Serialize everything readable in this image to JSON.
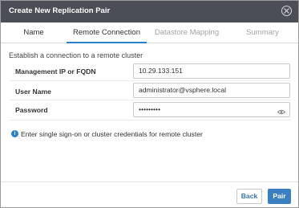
{
  "dialog": {
    "title": "Create New Replication Pair",
    "close_icon": "close-circle-icon"
  },
  "tabs": [
    {
      "label": "Name",
      "state": "normal"
    },
    {
      "label": "Remote Connection",
      "state": "active"
    },
    {
      "label": "Datastore Mapping",
      "state": "disabled"
    },
    {
      "label": "Summary",
      "state": "disabled"
    }
  ],
  "form": {
    "subtitle": "Establish a connection to a remote cluster",
    "management_ip": {
      "label": "Management IP or FQDN",
      "value": "10.29.133.151"
    },
    "user_name": {
      "label": "User Name",
      "value": "administrator@vsphere.local"
    },
    "password": {
      "label": "Password",
      "value": "•••••••••",
      "reveal_icon": "eye-icon"
    },
    "info": {
      "icon": "info-icon",
      "text": "Enter single sign-on or cluster credentials for remote cluster"
    }
  },
  "footer": {
    "back_label": "Back",
    "pair_label": "Pair"
  },
  "colors": {
    "titlebar": "#4b4f55",
    "accent": "#2a7fc9",
    "primary_button": "#3a7fc1"
  }
}
